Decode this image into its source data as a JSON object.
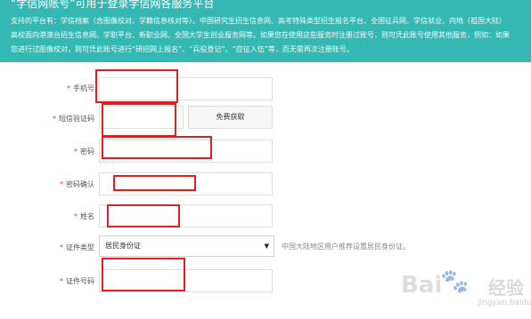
{
  "banner": {
    "title": "“学信网账号”可用于登录学信网各服务平台",
    "lines": [
      "支持的平台有：学信档案（含图像校对、学籍信息核对等）、中国研究生招生信息网、高考特殊类型招生报名平台、全国征兵网、学信就业、内地（祖国大陆）",
      "高校面向港澳台招生信息网、学职平台、新职业网、全国大学生创业服务网等。如果您在使用这些服务时注册过账号，则可凭此账号使用其他服务，例如：如果",
      "您进行过图像校对，则可凭此账号进行“研招网上报名”、“兵役登记”、“应征入伍”等，而无需再次注册账号。"
    ]
  },
  "form": {
    "required_mark": "*",
    "phone_label": "手机号",
    "phone_value": "",
    "sms_code_label": "短信验证码",
    "sms_code_value": "",
    "sms_button_label": "免费获取",
    "password_label": "密码",
    "password_value": "",
    "password_confirm_label": "密码确认",
    "password_confirm_value": "",
    "name_label": "姓名",
    "name_value": "",
    "id_type_label": "证件类型",
    "id_type_selected": "居民身份证",
    "id_type_hint": "中国大陆地区用户推荐设置居民身份证。",
    "id_number_label": "证件号码",
    "id_number_value": ""
  },
  "icons": {
    "select_caret": "caret-down-icon",
    "watermark_paw": "baidu-paw-icon"
  },
  "watermark": {
    "logo_text": "Bai",
    "logo_paw": "🐾",
    "brand_text": "经验",
    "url": "jingyan.baidu.com"
  },
  "colors": {
    "banner_bg": "#35b8b3",
    "highlight_box": "#e02020",
    "required_star": "#e33333"
  }
}
